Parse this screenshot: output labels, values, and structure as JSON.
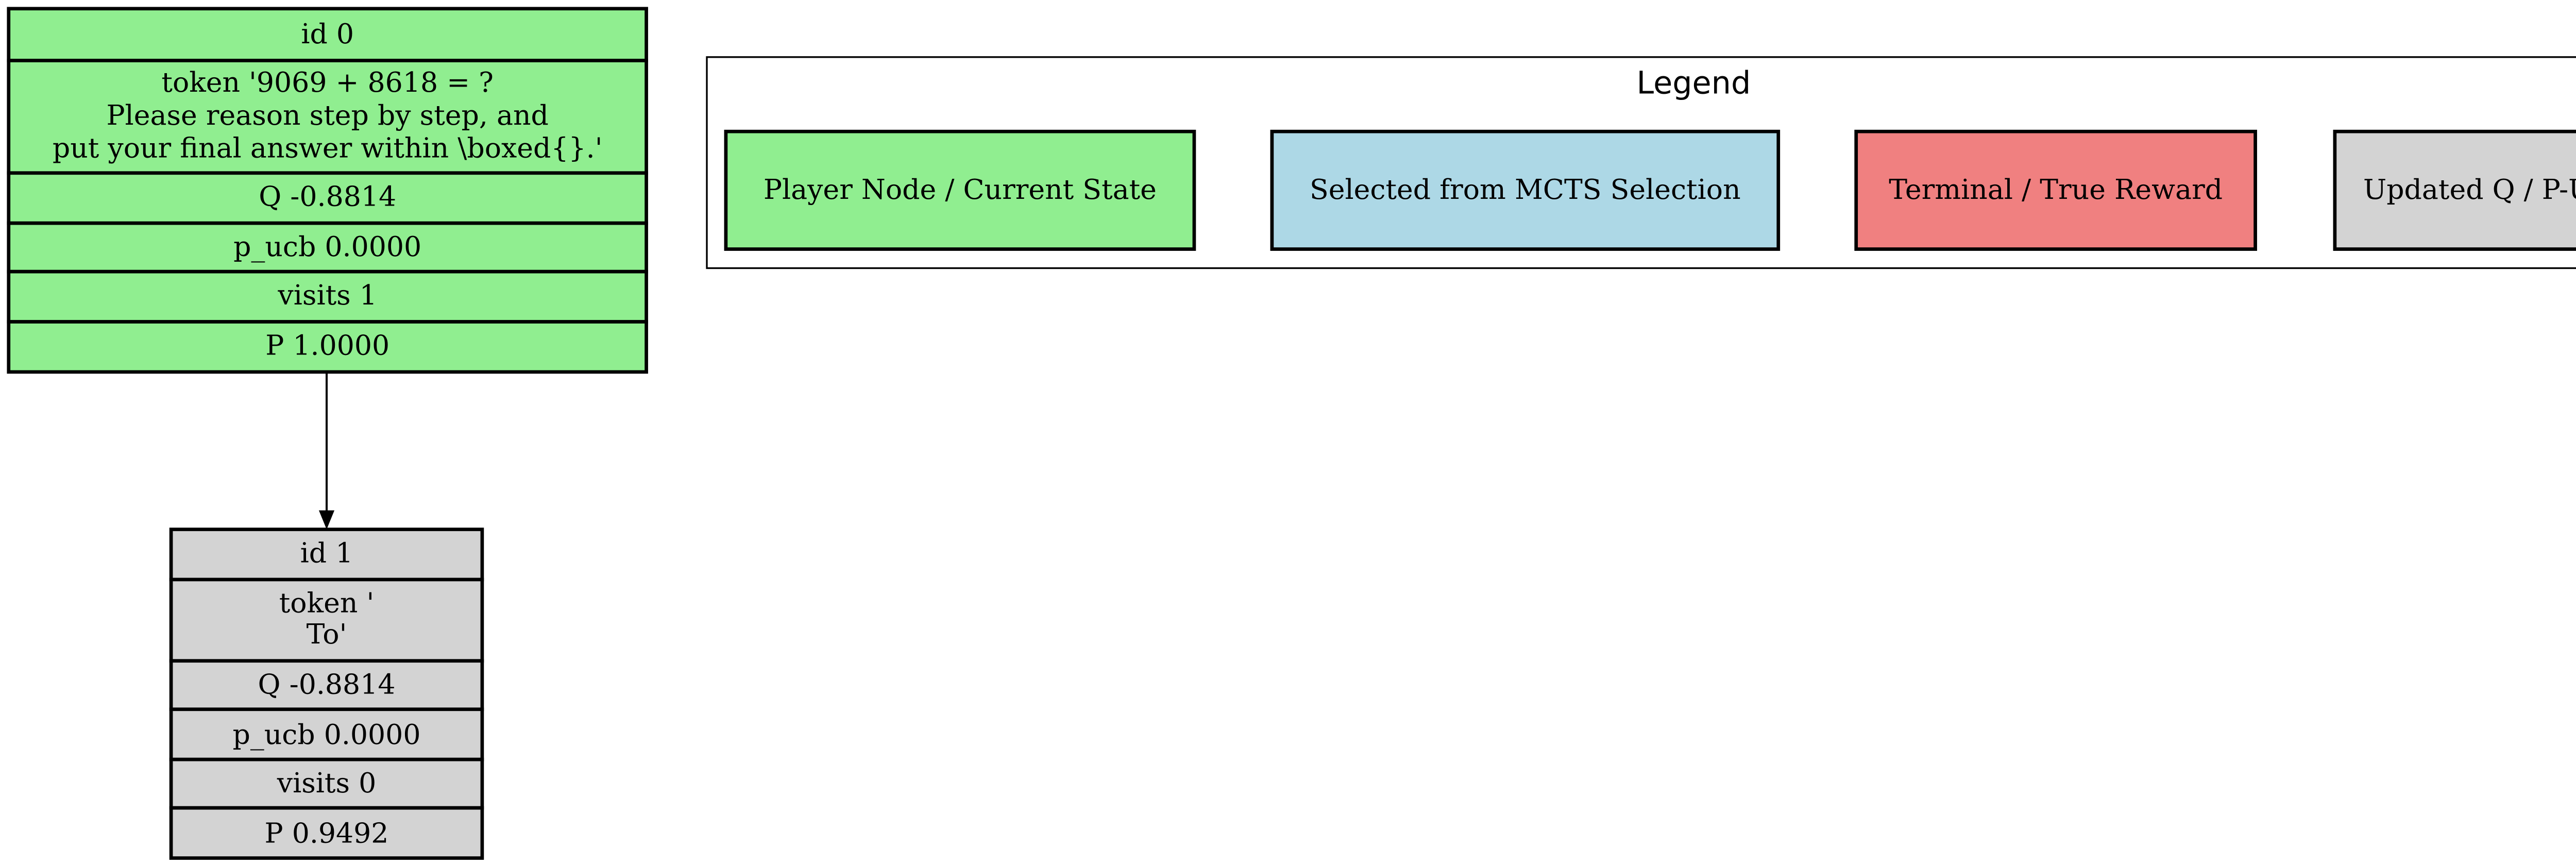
{
  "colors": {
    "player_node": "#90ee90",
    "selected": "#add8e6",
    "terminal": "#f08080",
    "updated": "#d3d3d3"
  },
  "nodes": [
    {
      "id": "id 0",
      "token_lines": [
        "token '9069 + 8618 = ?",
        "Please reason step by step, and",
        "put your final answer within \\boxed{}.'"
      ],
      "q": "Q -0.8814",
      "p_ucb": "p_ucb 0.0000",
      "visits": "visits 1",
      "p": "P 1.0000"
    },
    {
      "id": "id 1",
      "token_lines": [
        "token '",
        "To'"
      ],
      "q": "Q -0.8814",
      "p_ucb": "p_ucb 0.0000",
      "visits": "visits 0",
      "p": "P 0.9492"
    }
  ],
  "legend": {
    "title": "Legend",
    "items": [
      {
        "label": "Player Node / Current State"
      },
      {
        "label": "Selected from MCTS Selection"
      },
      {
        "label": "Terminal / True Reward"
      },
      {
        "label": "Updated Q / P-UCB"
      }
    ]
  }
}
